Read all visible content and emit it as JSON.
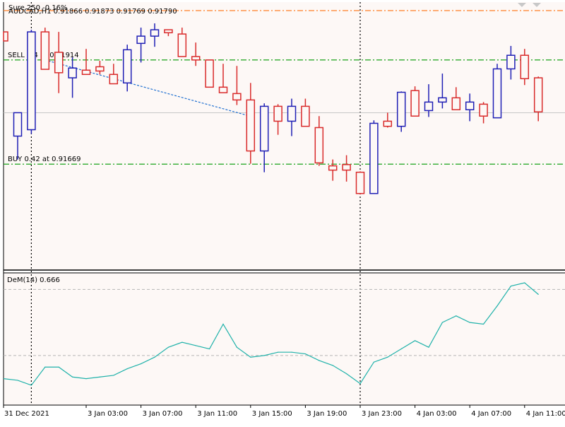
{
  "chart_data": [
    {
      "type": "candlestick",
      "header": "AUDCAD,H1  0.91866 0.91873 0.91769 0.91790",
      "overlay_label": "Sure 250 -0.16%",
      "colors": {
        "up": "#1f1fb5",
        "down": "#d92b2b",
        "background": "#fdf8f6"
      },
      "ylim": [
        0.9142,
        0.9205
      ],
      "levels": [
        {
          "label": "SELL 0.4 at 0.91914",
          "price": 0.91914,
          "color": "#009900",
          "style": "dash-dot"
        },
        {
          "label": "BUY 0.42 at 0.91669",
          "price": 0.91669,
          "color": "#009900",
          "style": "dash-dot"
        },
        {
          "label": "",
          "price": 0.9203,
          "color": "#ff7f27",
          "style": "dash-dot"
        },
        {
          "label": "",
          "price": 0.9179,
          "color": "#c0c0c0",
          "style": "solid"
        }
      ],
      "trade_line": {
        "from_bar": 2,
        "from_price": 0.91914,
        "to_bar": 17,
        "to_price": 0.91783,
        "color": "#1e6fd0"
      },
      "vertical_markers": [
        1,
        25
      ],
      "candles": [
        {
          "o": 0.91735,
          "h": 0.9179,
          "l": 0.9168,
          "c": 0.9179
        },
        {
          "o": 0.9175,
          "h": 0.91985,
          "l": 0.9174,
          "c": 0.9198
        },
        {
          "o": 0.9198,
          "h": 0.9199,
          "l": 0.91892,
          "c": 0.91892
        },
        {
          "o": 0.91932,
          "h": 0.9198,
          "l": 0.91836,
          "c": 0.91884
        },
        {
          "o": 0.91872,
          "h": 0.9192,
          "l": 0.91825,
          "c": 0.91895
        },
        {
          "o": 0.9189,
          "h": 0.9194,
          "l": 0.9188,
          "c": 0.9188
        },
        {
          "o": 0.91898,
          "h": 0.91912,
          "l": 0.9188,
          "c": 0.91888
        },
        {
          "o": 0.9188,
          "h": 0.91905,
          "l": 0.91858,
          "c": 0.91858
        },
        {
          "o": 0.9186,
          "h": 0.9195,
          "l": 0.9184,
          "c": 0.91938
        },
        {
          "o": 0.91953,
          "h": 0.9199,
          "l": 0.91908,
          "c": 0.9197
        },
        {
          "o": 0.9197,
          "h": 0.92,
          "l": 0.91945,
          "c": 0.91985
        },
        {
          "o": 0.91985,
          "h": 0.91985,
          "l": 0.9197,
          "c": 0.91978
        },
        {
          "o": 0.91975,
          "h": 0.9199,
          "l": 0.91922,
          "c": 0.91922
        },
        {
          "o": 0.91922,
          "h": 0.91955,
          "l": 0.919,
          "c": 0.91914
        },
        {
          "o": 0.91914,
          "h": 0.91915,
          "l": 0.91885,
          "c": 0.9185
        },
        {
          "o": 0.9185,
          "h": 0.91905,
          "l": 0.91837,
          "c": 0.91837
        },
        {
          "o": 0.91835,
          "h": 0.919,
          "l": 0.91808,
          "c": 0.9182
        },
        {
          "o": 0.9182,
          "h": 0.9186,
          "l": 0.9167,
          "c": 0.917
        },
        {
          "o": 0.917,
          "h": 0.91812,
          "l": 0.9165,
          "c": 0.91805
        },
        {
          "o": 0.91805,
          "h": 0.9181,
          "l": 0.91738,
          "c": 0.9177
        },
        {
          "o": 0.9177,
          "h": 0.91823,
          "l": 0.91735,
          "c": 0.91805
        },
        {
          "o": 0.91805,
          "h": 0.91823,
          "l": 0.91758,
          "c": 0.91758
        },
        {
          "o": 0.91755,
          "h": 0.91782,
          "l": 0.91665,
          "c": 0.91672
        },
        {
          "o": 0.91665,
          "h": 0.9168,
          "l": 0.9163,
          "c": 0.91655
        },
        {
          "o": 0.91668,
          "h": 0.9169,
          "l": 0.91628,
          "c": 0.91655
        },
        {
          "o": 0.9165,
          "h": 0.91652,
          "l": 0.91598,
          "c": 0.916
        },
        {
          "o": 0.916,
          "h": 0.91772,
          "l": 0.916,
          "c": 0.91765
        },
        {
          "o": 0.9177,
          "h": 0.9179,
          "l": 0.91755,
          "c": 0.91758
        },
        {
          "o": 0.91758,
          "h": 0.9184,
          "l": 0.91745,
          "c": 0.91838
        },
        {
          "o": 0.91842,
          "h": 0.91852,
          "l": 0.91782,
          "c": 0.91782
        },
        {
          "o": 0.91795,
          "h": 0.91857,
          "l": 0.9178,
          "c": 0.91815
        },
        {
          "o": 0.91815,
          "h": 0.91882,
          "l": 0.918,
          "c": 0.91825
        },
        {
          "o": 0.91825,
          "h": 0.9185,
          "l": 0.91797,
          "c": 0.91797
        },
        {
          "o": 0.91797,
          "h": 0.91835,
          "l": 0.9177,
          "c": 0.91815
        },
        {
          "o": 0.9181,
          "h": 0.91815,
          "l": 0.91765,
          "c": 0.91782
        },
        {
          "o": 0.91778,
          "h": 0.91905,
          "l": 0.91778,
          "c": 0.91893
        },
        {
          "o": 0.91893,
          "h": 0.91947,
          "l": 0.91868,
          "c": 0.91925
        },
        {
          "o": 0.91925,
          "h": 0.9194,
          "l": 0.91855,
          "c": 0.9187
        },
        {
          "o": 0.91872,
          "h": 0.91875,
          "l": 0.9177,
          "c": 0.91792
        }
      ]
    },
    {
      "type": "line",
      "title": "DeM(14) 0.666",
      "ylim": [
        0.0,
        0.8
      ],
      "levels": [
        0.7,
        0.3
      ],
      "color": "#20b2aa",
      "values": [
        0.15,
        0.12,
        0.23,
        0.23,
        0.17,
        0.16,
        0.17,
        0.18,
        0.22,
        0.25,
        0.29,
        0.35,
        0.38,
        0.36,
        0.34,
        0.49,
        0.35,
        0.29,
        0.3,
        0.32,
        0.32,
        0.31,
        0.27,
        0.24,
        0.19,
        0.13,
        0.26,
        0.29,
        0.34,
        0.39,
        0.35,
        0.5,
        0.54,
        0.5,
        0.49,
        0.6,
        0.72,
        0.74,
        0.67
      ]
    }
  ],
  "x_axis": {
    "labels": [
      "31 Dec 2021",
      "3 Jan 03:00",
      "3 Jan 07:00",
      "3 Jan 11:00",
      "3 Jan 15:00",
      "3 Jan 19:00",
      "3 Jan 23:00",
      "4 Jan 03:00",
      "4 Jan 07:00",
      "4 Jan 11:00"
    ],
    "label_bars": [
      0,
      5,
      9,
      13,
      17,
      21,
      25,
      29,
      33,
      37
    ]
  }
}
